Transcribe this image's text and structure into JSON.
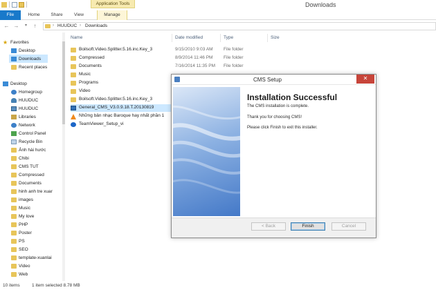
{
  "window": {
    "title": "Downloads",
    "contextual_group": "Application Tools"
  },
  "ribbon": {
    "tabs": [
      {
        "label": "File"
      },
      {
        "label": "Home"
      },
      {
        "label": "Share"
      },
      {
        "label": "View"
      },
      {
        "label": "Manage"
      }
    ]
  },
  "address": {
    "crumbs": [
      "HUUDUC",
      "Downloads"
    ]
  },
  "columns": {
    "name": "Name",
    "date": "Date modified",
    "type": "Type",
    "size": "Size"
  },
  "nav": {
    "favorites_header": "Favorites",
    "favorites": [
      "Desktop",
      "Downloads",
      "Recent places"
    ],
    "desktop_header": "Desktop",
    "desktop_items": [
      "Homegroup",
      "HUUDUC",
      "HUUDUC",
      "Libraries",
      "Network",
      "Control Panel",
      "Recycle Bin",
      "Ảnh hài hước",
      "Chibi",
      "CMS TUT",
      "Compressed",
      "Documents",
      "hinh anh tre xuar",
      "images",
      "Music",
      "My love",
      "PHP",
      "Poster",
      "PS",
      "SEO",
      "template-xuanlai",
      "Video",
      "Web"
    ]
  },
  "files": [
    {
      "name": "Boilsoft.Video.Splitter.5.16.inc.Key_3",
      "date": "9/15/2010 9:03 AM",
      "type": "File folder",
      "icon": "folder-icon"
    },
    {
      "name": "Compressed",
      "date": "8/9/2014 11:46 PM",
      "type": "File folder",
      "icon": "folder-icon"
    },
    {
      "name": "Documents",
      "date": "7/16/2014 11:35 PM",
      "type": "File folder",
      "icon": "folder-icon"
    },
    {
      "name": "Music",
      "date": "",
      "type": "",
      "icon": "folder-icon"
    },
    {
      "name": "Programs",
      "date": "",
      "type": "",
      "icon": "folder-icon"
    },
    {
      "name": "Video",
      "date": "",
      "type": "",
      "icon": "folder-icon"
    },
    {
      "name": "Boilsoft.Video.Splitter.5.16.inc.Key_3",
      "date": "",
      "type": "",
      "icon": "folder-icon"
    },
    {
      "name": "General_CMS_V3.0.9.18.T.20130819",
      "date": "",
      "type": "",
      "icon": "installer-icon"
    },
    {
      "name": "Những bản nhạc Baroque hay nhất phần 1",
      "date": "",
      "type": "",
      "icon": "vlc-icon"
    },
    {
      "name": "TeamViewer_Setup_vi",
      "date": "",
      "type": "",
      "icon": "teamviewer-icon"
    }
  ],
  "status": {
    "count": "10 items",
    "selection": "1 item selected  8.78 MB"
  },
  "dialog": {
    "title": "CMS Setup",
    "heading": "Installation Successful",
    "lines": [
      "The CMS  installation is complete.",
      "Thank you for choosing CMS!",
      "Please click Finish to exit this installer."
    ],
    "back_label": "< Back",
    "finish_label": "Finish",
    "cancel_label": "Cancel"
  },
  "colors": {
    "accent": "#1979ca",
    "selection": "#cce8ff",
    "close": "#c7453a",
    "app_tools": "#f7eab0"
  }
}
